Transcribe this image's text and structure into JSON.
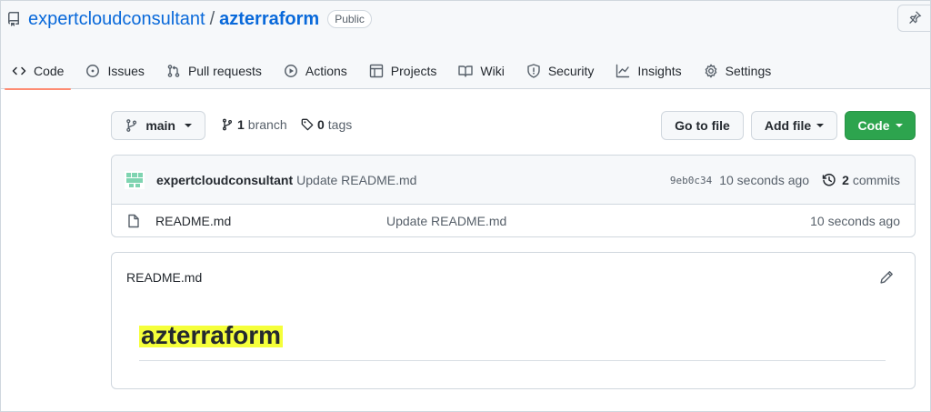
{
  "repo": {
    "owner": "expertcloudconsultant",
    "separator": "/",
    "name": "azterraform",
    "visibility": "Public"
  },
  "tabs": [
    {
      "label": "Code",
      "icon": "code-icon",
      "active": true
    },
    {
      "label": "Issues",
      "icon": "issue-opened-icon"
    },
    {
      "label": "Pull requests",
      "icon": "git-pull-request-icon"
    },
    {
      "label": "Actions",
      "icon": "play-icon"
    },
    {
      "label": "Projects",
      "icon": "table-icon"
    },
    {
      "label": "Wiki",
      "icon": "book-icon"
    },
    {
      "label": "Security",
      "icon": "shield-icon"
    },
    {
      "label": "Insights",
      "icon": "graph-icon"
    },
    {
      "label": "Settings",
      "icon": "gear-icon"
    }
  ],
  "toolbar": {
    "branch": "main",
    "branch_count": "1",
    "branch_label": "branch",
    "tag_count": "0",
    "tag_label": "tags",
    "go_to_file": "Go to file",
    "add_file": "Add file",
    "code": "Code"
  },
  "latest_commit": {
    "author": "expertcloudconsultant",
    "message": "Update README.md",
    "sha": "9eb0c34",
    "time": "10 seconds ago",
    "commit_count": "2",
    "commit_label": "commits"
  },
  "files": [
    {
      "name": "README.md",
      "message": "Update README.md",
      "time": "10 seconds ago"
    }
  ],
  "readme": {
    "filename": "README.md",
    "heading": "azterraform"
  },
  "colors": {
    "link": "#0969da",
    "green_button": "#2da44e",
    "active_tab_underline": "#fd8c73",
    "highlight": "#f5ff3a"
  }
}
